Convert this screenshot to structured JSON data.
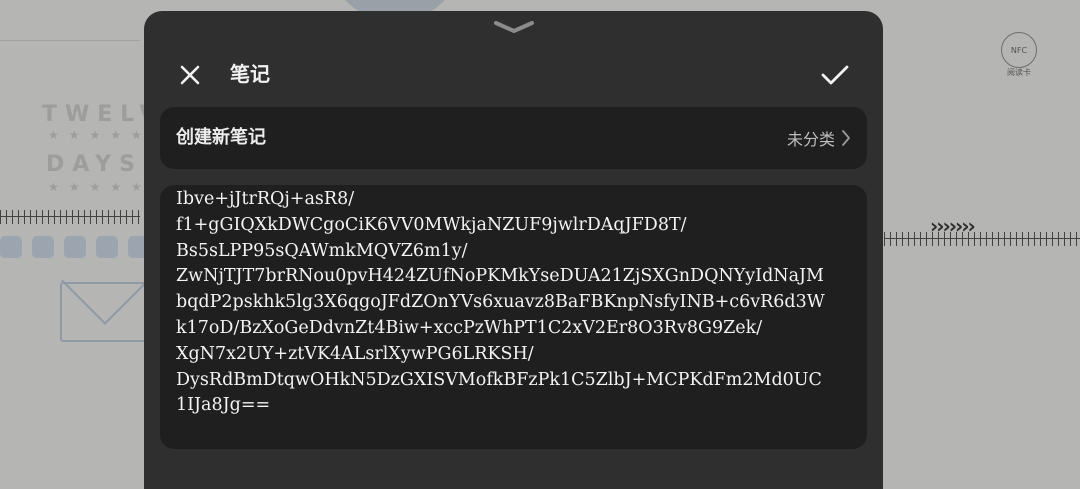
{
  "background": {
    "ghost_text_1": "TWELVE",
    "ghost_text_2": "DAYS",
    "nfc_badge": "NFC",
    "nfc_caption": "阅读卡"
  },
  "sheet": {
    "title": "笔记",
    "icons": {
      "handle": "chevron-down-icon",
      "close": "close-icon",
      "confirm": "checkmark-icon",
      "category_arrow": "chevron-right-icon"
    },
    "note_title": "创建新笔记",
    "category": "未分类",
    "content_lines": [
      "Ibve+jJtrRQj+asR8/",
      "f1+gGIQXkDWCgoCiK6VV0MWkjaNZUF9jwlrDAqJFD8T/",
      "Bs5sLPP95sQAWmkMQVZ6m1y/",
      "ZwNjTJT7brRNou0pvH424ZUfNoPKMkYseDUA21ZjSXGnDQNYyIdNaJM",
      "bqdP2pskhk5lg3X6qgoJFdZOnYVs6xuavz8BaFBKnpNsfyINB+c6vR6d3W",
      "k17oD/BzXoGeDdvnZt4Biw+xccPzWhPT1C2xV2Er8O3Rv8G9Zek/",
      "XgN7x2UY+ztVK4ALsrlXywPG6LRKSH/",
      "DysRdBmDtqwOHkN5DzGXISVMofkBFzPk1C5ZlbJ+MCPKdFm2Md0UC",
      "1IJa8Jg=="
    ]
  },
  "colors": {
    "sheet_bg": "#2f2f2f",
    "field_bg": "#1f1f1f",
    "text_primary": "#f2f2f2",
    "text_secondary": "#bdbdbd"
  }
}
